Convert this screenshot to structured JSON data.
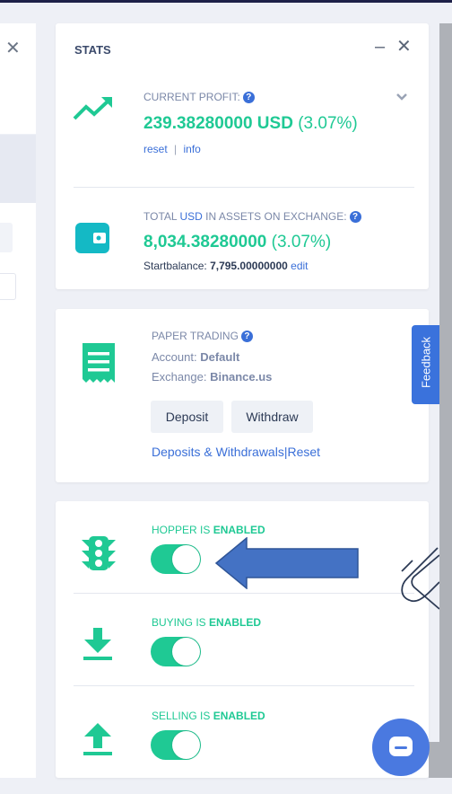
{
  "stats": {
    "title": "STATS",
    "minimize": "–",
    "close": "✕",
    "current_profit": {
      "label": "CURRENT PROFIT:",
      "help": "?",
      "amount": "239.38280000 USD",
      "percent": "(3.07%)",
      "reset": "reset",
      "separator": "|",
      "info": "info"
    },
    "total_assets": {
      "label_prefix": "TOTAL",
      "currency": "USD",
      "label_suffix": "IN ASSETS ON EXCHANGE:",
      "help": "?",
      "amount": "8,034.38280000",
      "percent": "(3.07%)",
      "startbalance_label": "Startbalance:",
      "startbalance_value": "7,795.00000000",
      "edit": "edit"
    }
  },
  "paper_trading": {
    "title": "PAPER TRADING",
    "help": "?",
    "account_label": "Account:",
    "account_value": "Default",
    "exchange_label": "Exchange:",
    "exchange_value": "Binance.us",
    "deposit_button": "Deposit",
    "withdraw_button": "Withdraw",
    "deposits_link": "Deposits & Withdrawals",
    "separator": "|",
    "reset_link": "Reset"
  },
  "toggles": [
    {
      "label": "HOPPER IS",
      "state": "ENABLED",
      "on": true
    },
    {
      "label": "BUYING IS",
      "state": "ENABLED",
      "on": true
    },
    {
      "label": "SELLING IS",
      "state": "ENABLED",
      "on": true
    }
  ],
  "left_panel": {
    "close": "✕"
  },
  "feedback": {
    "label": "Feedback"
  },
  "colors": {
    "accent_green": "#1fc994",
    "link_blue": "#3a6fd8",
    "annotation_arrow": "#4472c4"
  },
  "icons": [
    "trend-up-icon",
    "wallet-icon",
    "receipt-icon",
    "traffic-light-icon",
    "download-icon",
    "upload-icon",
    "chat-icon",
    "chevron-down-icon",
    "paperclip-icon"
  ]
}
